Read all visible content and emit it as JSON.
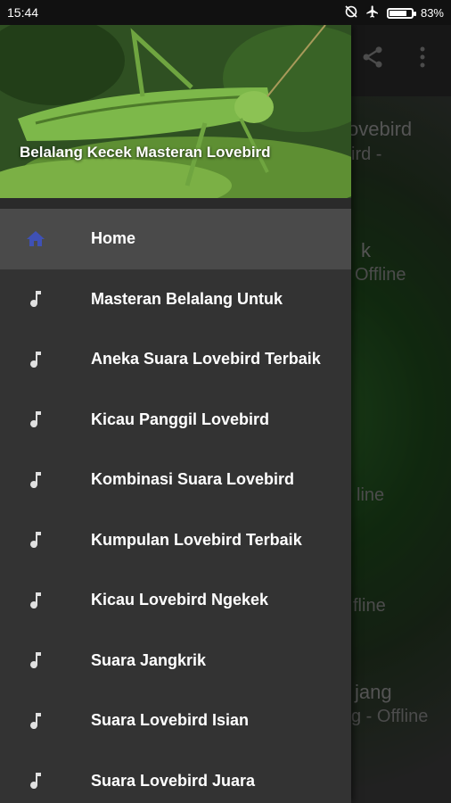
{
  "status_bar": {
    "time": "15:44",
    "battery": "83%",
    "battery_level": 0.83
  },
  "background": {
    "titles": [
      "ovebird",
      "ird -",
      "k",
      "Offline",
      "line",
      "fline",
      "jang",
      "g - Offline"
    ]
  },
  "drawer": {
    "header_title": "Belalang Kecek Masteran Lovebird",
    "items": [
      {
        "label": "Home",
        "icon": "home-icon",
        "active": true
      },
      {
        "label": "Masteran Belalang Untuk",
        "icon": "music-note-icon"
      },
      {
        "label": "Aneka Suara Lovebird Terbaik",
        "icon": "music-note-icon"
      },
      {
        "label": "Kicau Panggil Lovebird",
        "icon": "music-note-icon"
      },
      {
        "label": "Kombinasi Suara Lovebird",
        "icon": "music-note-icon"
      },
      {
        "label": "Kumpulan Lovebird Terbaik",
        "icon": "music-note-icon"
      },
      {
        "label": "Kicau Lovebird Ngekek",
        "icon": "music-note-icon"
      },
      {
        "label": "Suara Jangkrik",
        "icon": "music-note-icon"
      },
      {
        "label": "Suara Lovebird Isian",
        "icon": "music-note-icon"
      },
      {
        "label": "Suara Lovebird Juara",
        "icon": "music-note-icon"
      }
    ]
  },
  "colors": {
    "active_icon": "#3f51b5",
    "note_icon": "#e0e0e0"
  }
}
